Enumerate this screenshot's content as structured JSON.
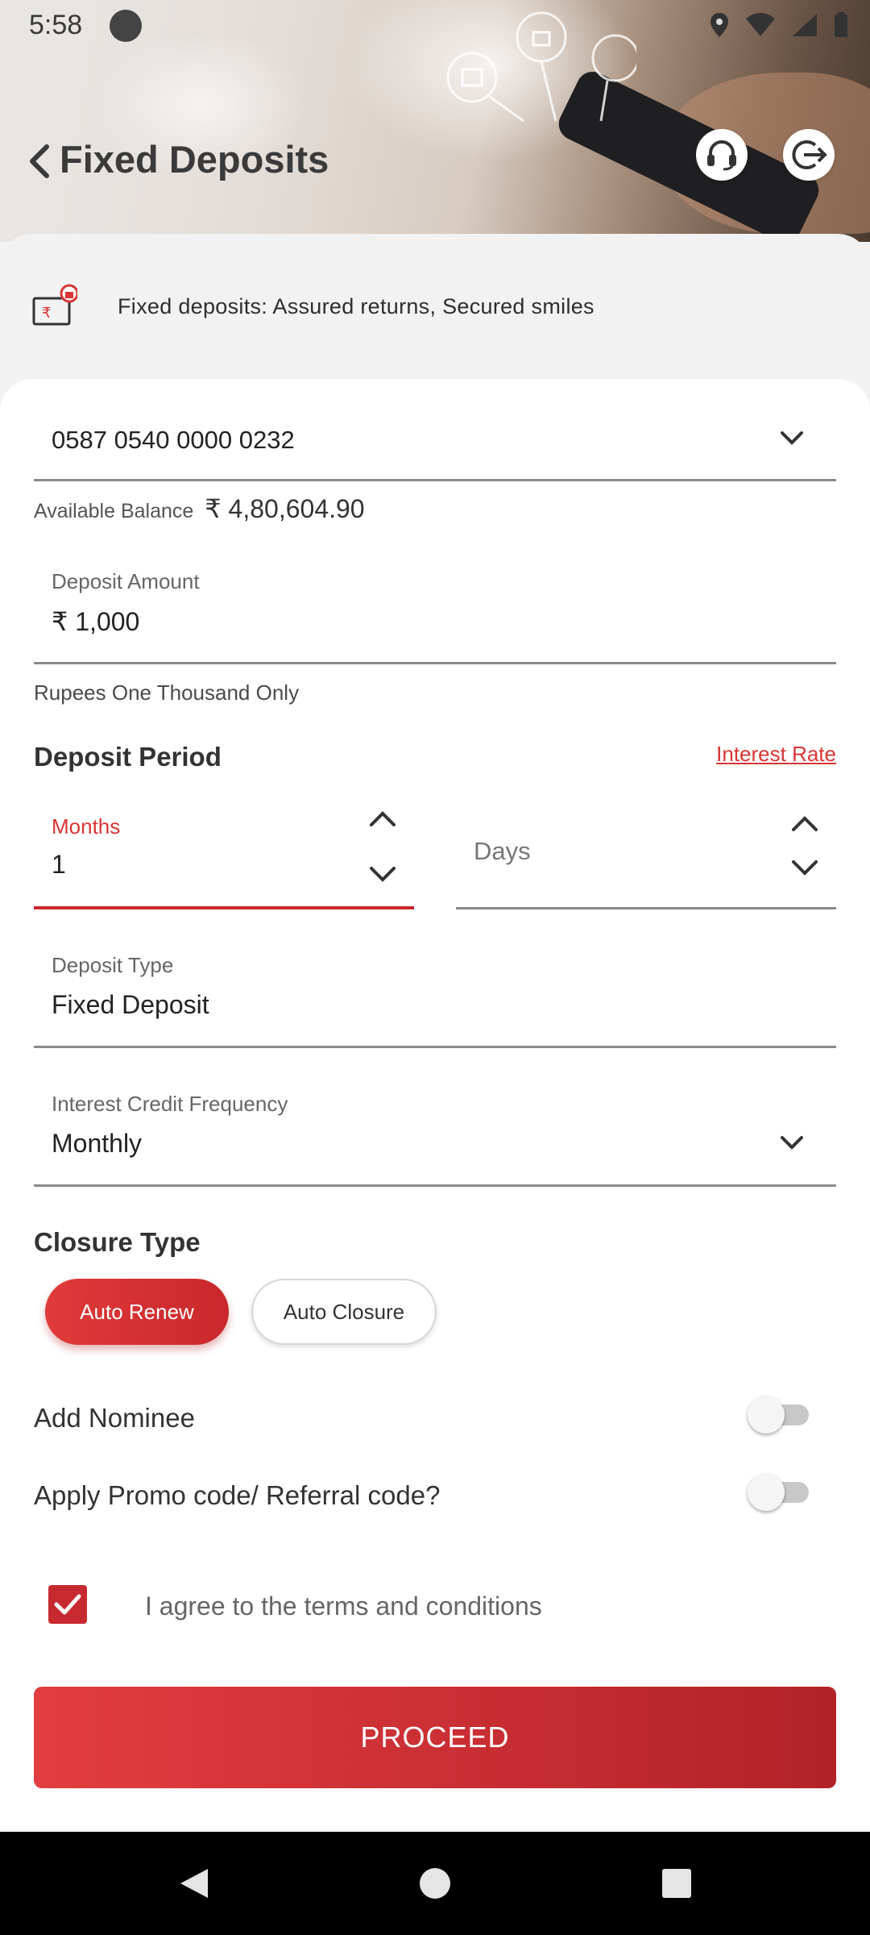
{
  "status_bar": {
    "time": "5:58"
  },
  "header": {
    "title": "Fixed Deposits"
  },
  "banner": {
    "text": "Fixed deposits: Assured returns, Secured smiles"
  },
  "account": {
    "number": "0587 0540 0000 0232"
  },
  "balance": {
    "label": "Available Balance",
    "value": "₹ 4,80,604.90"
  },
  "deposit_amount": {
    "label": "Deposit Amount",
    "value": "₹ 1,000",
    "in_words": "Rupees One Thousand Only"
  },
  "deposit_period": {
    "title": "Deposit Period",
    "interest_rate_link": "Interest Rate",
    "months": {
      "label": "Months",
      "value": "1"
    },
    "days": {
      "placeholder": "Days"
    }
  },
  "deposit_type": {
    "label": "Deposit Type",
    "value": "Fixed Deposit"
  },
  "interest_frequency": {
    "label": "Interest Credit Frequency",
    "value": "Monthly"
  },
  "closure_type": {
    "title": "Closure Type",
    "options": [
      "Auto Renew",
      "Auto Closure"
    ],
    "selected": "Auto Renew"
  },
  "add_nominee": {
    "label": "Add Nominee",
    "enabled": false
  },
  "promo_code": {
    "label": "Apply Promo code/ Referral code?",
    "enabled": false
  },
  "terms": {
    "label": "I agree to the terms and conditions",
    "checked": true
  },
  "proceed_button": {
    "label": "PROCEED"
  },
  "colors": {
    "accent": "#d93535",
    "primary_button": "#c9282c"
  }
}
